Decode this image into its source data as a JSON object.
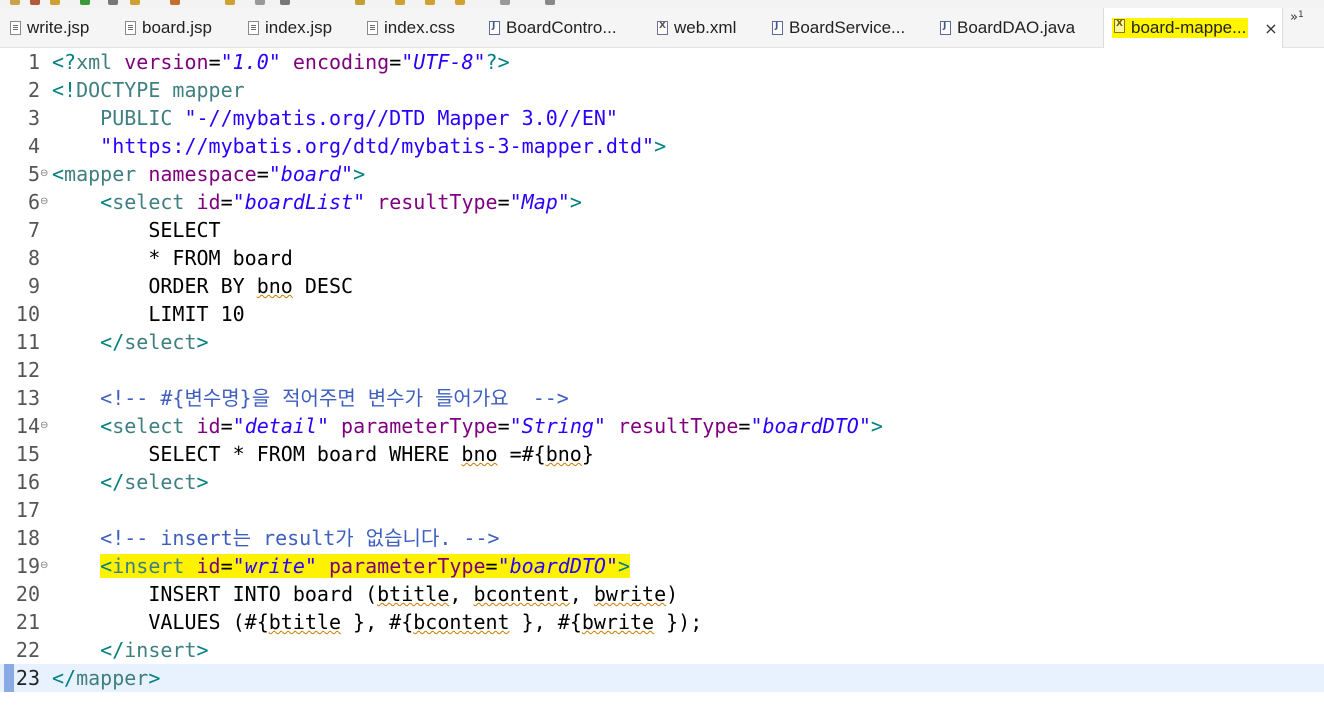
{
  "tabs": [
    {
      "label": "write.jsp",
      "icon": "jsp-file-icon",
      "active": false
    },
    {
      "label": "board.jsp",
      "icon": "jsp-file-icon",
      "active": false
    },
    {
      "label": "index.jsp",
      "icon": "jsp-file-icon",
      "active": false
    },
    {
      "label": "index.css",
      "icon": "css-file-icon",
      "active": false
    },
    {
      "label": "BoardContro...",
      "icon": "java-file-icon",
      "active": false
    },
    {
      "label": "web.xml",
      "icon": "xml-file-icon",
      "active": false
    },
    {
      "label": "BoardService...",
      "icon": "java-file-icon",
      "active": false
    },
    {
      "label": "BoardDAO.java",
      "icon": "java-file-icon",
      "active": false
    },
    {
      "label": "board-mappe...",
      "icon": "xml-file-icon",
      "active": true
    }
  ],
  "close_symbol": "×",
  "more_tabs_symbol": "»",
  "more_tabs_count": "1",
  "highlight_color": "#fff200",
  "editor": {
    "current_line": 23,
    "line_numbers": [
      "1",
      "2",
      "3",
      "4",
      "5",
      "6",
      "7",
      "8",
      "9",
      "10",
      "11",
      "12",
      "13",
      "14",
      "15",
      "16",
      "17",
      "18",
      "19",
      "20",
      "21",
      "22",
      "23"
    ],
    "fold_marker": "⊖",
    "lines": [
      {
        "parts": [
          [
            "br",
            "<?"
          ],
          [
            "tag",
            "xml"
          ],
          [
            "txt",
            " "
          ],
          [
            "attr",
            "version"
          ],
          [
            "txt",
            "="
          ],
          [
            "val",
            "\"1.0\""
          ],
          [
            "txt",
            " "
          ],
          [
            "attr",
            "encoding"
          ],
          [
            "txt",
            "="
          ],
          [
            "val",
            "\"UTF-8\""
          ],
          [
            "br",
            "?>"
          ]
        ]
      },
      {
        "parts": [
          [
            "br",
            "<!"
          ],
          [
            "dt",
            "DOCTYPE mapper"
          ]
        ]
      },
      {
        "parts": [
          [
            "txt",
            "    "
          ],
          [
            "dt",
            "PUBLIC "
          ],
          [
            "str",
            "\"-//mybatis.org//DTD Mapper 3.0//EN\""
          ]
        ]
      },
      {
        "parts": [
          [
            "txt",
            "    "
          ],
          [
            "str",
            "\"https://mybatis.org/dtd/mybatis-3-mapper.dtd\""
          ],
          [
            "br",
            ">"
          ]
        ]
      },
      {
        "parts": [
          [
            "br",
            "<"
          ],
          [
            "tag",
            "mapper"
          ],
          [
            "txt",
            " "
          ],
          [
            "attr",
            "namespace"
          ],
          [
            "txt",
            "="
          ],
          [
            "val",
            "\"board\""
          ],
          [
            "br",
            ">"
          ]
        ]
      },
      {
        "parts": [
          [
            "txt",
            "    "
          ],
          [
            "br",
            "<"
          ],
          [
            "tag",
            "select"
          ],
          [
            "txt",
            " "
          ],
          [
            "attr",
            "id"
          ],
          [
            "txt",
            "="
          ],
          [
            "val",
            "\"boardList\""
          ],
          [
            "txt",
            " "
          ],
          [
            "attr",
            "resultType"
          ],
          [
            "txt",
            "="
          ],
          [
            "val",
            "\"Map\""
          ],
          [
            "br",
            ">"
          ]
        ]
      },
      {
        "parts": [
          [
            "txt",
            "        SELECT"
          ]
        ]
      },
      {
        "parts": [
          [
            "txt",
            "        * FROM board"
          ]
        ]
      },
      {
        "parts": [
          [
            "txt",
            "        ORDER BY "
          ],
          [
            "sq",
            "bno"
          ],
          [
            "txt",
            " DESC"
          ]
        ]
      },
      {
        "parts": [
          [
            "txt",
            "        LIMIT 10"
          ]
        ]
      },
      {
        "parts": [
          [
            "txt",
            "    "
          ],
          [
            "br",
            "</"
          ],
          [
            "tag",
            "select"
          ],
          [
            "br",
            ">"
          ]
        ]
      },
      {
        "parts": []
      },
      {
        "parts": [
          [
            "txt",
            "    "
          ],
          [
            "cmt",
            "<!-- #{변수명}을 적어주면 변수가 들어가요  -->"
          ]
        ]
      },
      {
        "parts": [
          [
            "txt",
            "    "
          ],
          [
            "br",
            "<"
          ],
          [
            "tag",
            "select"
          ],
          [
            "txt",
            " "
          ],
          [
            "attr",
            "id"
          ],
          [
            "txt",
            "="
          ],
          [
            "val",
            "\"detail\""
          ],
          [
            "txt",
            " "
          ],
          [
            "attr",
            "parameterType"
          ],
          [
            "txt",
            "="
          ],
          [
            "val",
            "\"String\""
          ],
          [
            "txt",
            " "
          ],
          [
            "attr",
            "resultType"
          ],
          [
            "txt",
            "="
          ],
          [
            "val",
            "\"boardDTO\""
          ],
          [
            "br",
            ">"
          ]
        ]
      },
      {
        "parts": [
          [
            "txt",
            "        SELECT * FROM board WHERE "
          ],
          [
            "sq",
            "bno"
          ],
          [
            "txt",
            " =#{"
          ],
          [
            "sq",
            "bno"
          ],
          [
            "txt",
            "}"
          ]
        ]
      },
      {
        "parts": [
          [
            "txt",
            "    "
          ],
          [
            "br",
            "</"
          ],
          [
            "tag",
            "select"
          ],
          [
            "br",
            ">"
          ]
        ]
      },
      {
        "parts": []
      },
      {
        "parts": [
          [
            "txt",
            "    "
          ],
          [
            "cmt",
            "<!-- insert는 result가 없습니다. -->"
          ]
        ]
      },
      {
        "highlight": true,
        "parts": [
          [
            "txt",
            "    "
          ],
          [
            "br",
            "<"
          ],
          [
            "tag",
            "insert"
          ],
          [
            "txt",
            " "
          ],
          [
            "attr",
            "id"
          ],
          [
            "txt",
            "="
          ],
          [
            "val",
            "\"write\""
          ],
          [
            "txt",
            " "
          ],
          [
            "attr",
            "parameterType"
          ],
          [
            "txt",
            "="
          ],
          [
            "val",
            "\"boardDTO\""
          ],
          [
            "br",
            ">"
          ]
        ]
      },
      {
        "parts": [
          [
            "txt",
            "        INSERT INTO board ("
          ],
          [
            "sq",
            "btitle"
          ],
          [
            "txt",
            ", "
          ],
          [
            "sq",
            "bcontent"
          ],
          [
            "txt",
            ", "
          ],
          [
            "sq",
            "bwrite"
          ],
          [
            "txt",
            ")"
          ]
        ]
      },
      {
        "parts": [
          [
            "txt",
            "        VALUES (#{"
          ],
          [
            "sq",
            "btitle"
          ],
          [
            "txt",
            " }, #{"
          ],
          [
            "sq",
            "bcontent"
          ],
          [
            "txt",
            " }, #{"
          ],
          [
            "sq",
            "bwrite"
          ],
          [
            "txt",
            " });"
          ]
        ]
      },
      {
        "parts": [
          [
            "txt",
            "    "
          ],
          [
            "br",
            "</"
          ],
          [
            "tag",
            "insert"
          ],
          [
            "br",
            ">"
          ]
        ]
      },
      {
        "parts": [
          [
            "br",
            "</"
          ],
          [
            "tag",
            "mapper"
          ],
          [
            "br",
            ">"
          ]
        ]
      }
    ],
    "fold_lines": [
      5,
      6,
      14,
      19
    ]
  }
}
